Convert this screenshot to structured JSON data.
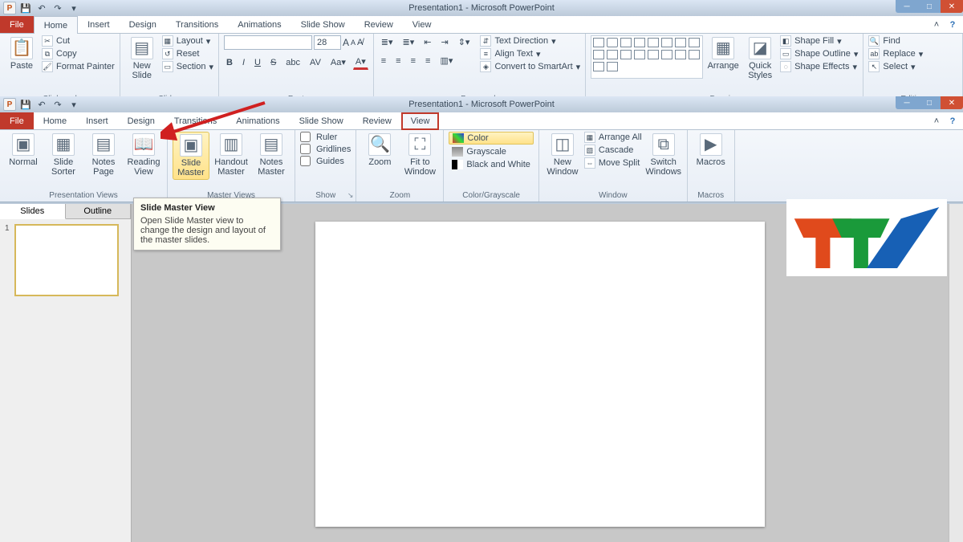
{
  "app": {
    "title": "Presentation1 - Microsoft PowerPoint",
    "icon_letter": "P"
  },
  "tabs_home": [
    "File",
    "Home",
    "Insert",
    "Design",
    "Transitions",
    "Animations",
    "Slide Show",
    "Review",
    "View"
  ],
  "tabs_view": [
    "File",
    "Home",
    "Insert",
    "Design",
    "Transitions",
    "Animations",
    "Slide Show",
    "Review",
    "View"
  ],
  "active_tab_top": "Home",
  "active_tab_bottom": "View",
  "home_ribbon": {
    "clipboard": {
      "label": "Clipboard",
      "paste": "Paste",
      "cut": "Cut",
      "copy": "Copy",
      "fmtpainter": "Format Painter"
    },
    "slides": {
      "label": "Slides",
      "newslide": "New Slide",
      "layout": "Layout",
      "reset": "Reset",
      "section": "Section"
    },
    "font": {
      "label": "Font",
      "size": "28"
    },
    "paragraph": {
      "label": "Paragraph",
      "textdir": "Text Direction",
      "align": "Align Text",
      "smart": "Convert to SmartArt"
    },
    "drawing": {
      "label": "Drawing",
      "arrange": "Arrange",
      "quick": "Quick Styles",
      "fill": "Shape Fill",
      "outline": "Shape Outline",
      "effects": "Shape Effects"
    },
    "editing": {
      "label": "Editing",
      "find": "Find",
      "replace": "Replace",
      "select": "Select"
    }
  },
  "view_ribbon": {
    "pres_views": {
      "label": "Presentation Views",
      "normal": "Normal",
      "sorter": "Slide Sorter",
      "notes": "Notes Page",
      "reading": "Reading View"
    },
    "master_views": {
      "label": "Master Views",
      "slide": "Slide Master",
      "handout": "Handout Master",
      "notesm": "Notes Master"
    },
    "show": {
      "label": "Show",
      "ruler": "Ruler",
      "gridlines": "Gridlines",
      "guides": "Guides"
    },
    "zoom": {
      "label": "Zoom",
      "zoom": "Zoom",
      "fit": "Fit to Window"
    },
    "colorg": {
      "label": "Color/Grayscale",
      "color": "Color",
      "gray": "Grayscale",
      "bw": "Black and White"
    },
    "window": {
      "label": "Window",
      "neww": "New Window",
      "arrange": "Arrange All",
      "cascade": "Cascade",
      "split": "Move Split",
      "switch": "Switch Windows"
    },
    "macros": {
      "label": "Macros",
      "macros": "Macros"
    }
  },
  "tooltip": {
    "title": "Slide Master View",
    "body": "Open Slide Master view to change the design and layout of the master slides."
  },
  "sidepane": {
    "tab1": "Slides",
    "tab2": "Outline",
    "slide_num": "1"
  }
}
